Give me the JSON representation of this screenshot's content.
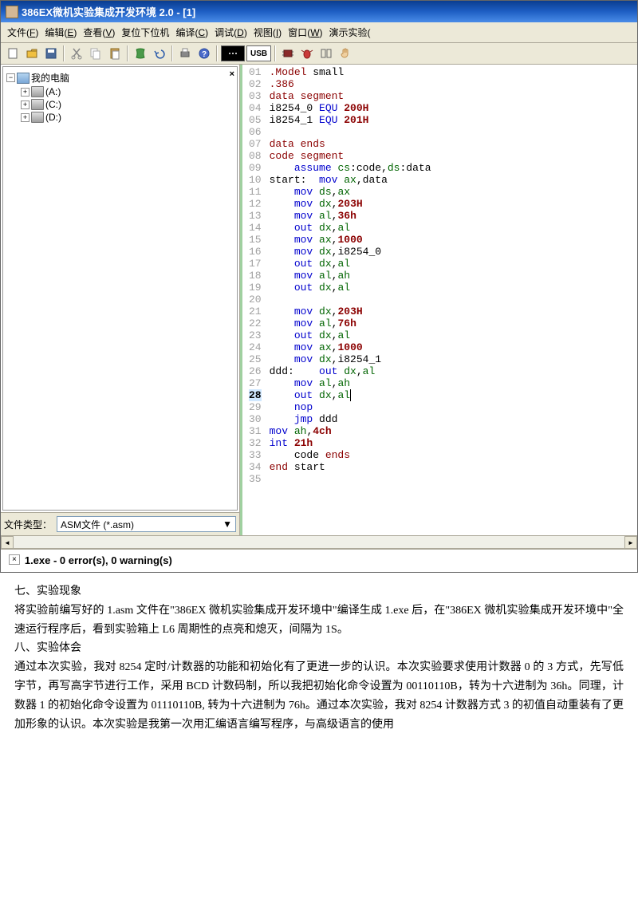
{
  "window": {
    "title": "386EX微机实验集成开发环境 2.0 - [1]"
  },
  "menu": {
    "file": {
      "label": "文件",
      "hotkey": "F"
    },
    "edit": {
      "label": "编辑",
      "hotkey": "E"
    },
    "view": {
      "label": "查看",
      "hotkey": "V"
    },
    "reset": {
      "label": "复位下位机"
    },
    "compile": {
      "label": "编译",
      "hotkey": "C"
    },
    "debug": {
      "label": "调试",
      "hotkey": "D"
    },
    "viewport": {
      "label": "视图",
      "hotkey": "I"
    },
    "window": {
      "label": "窗口",
      "hotkey": "W"
    },
    "demo": {
      "label": "演示实验"
    }
  },
  "toolbar": {
    "usb": "USB"
  },
  "tree": {
    "root": "我的电脑",
    "drives": [
      "(A:)",
      "(C:)",
      "(D:)"
    ]
  },
  "filetype": {
    "label": "文件类型：",
    "value": "ASM文件 (*.asm)"
  },
  "code": {
    "lines": [
      {
        "n": "01",
        "tokens": [
          [
            "dir",
            ".Model"
          ],
          [
            "plain",
            " small"
          ]
        ]
      },
      {
        "n": "02",
        "tokens": [
          [
            "dir",
            ".386"
          ]
        ]
      },
      {
        "n": "03",
        "tokens": [
          [
            "dir",
            "data segment"
          ]
        ]
      },
      {
        "n": "04",
        "tokens": [
          [
            "plain",
            "i8254_0 "
          ],
          [
            "inst",
            "EQU"
          ],
          [
            "plain",
            " "
          ],
          [
            "num",
            "200H"
          ]
        ]
      },
      {
        "n": "05",
        "tokens": [
          [
            "plain",
            "i8254_1 "
          ],
          [
            "inst",
            "EQU"
          ],
          [
            "plain",
            " "
          ],
          [
            "num",
            "201H"
          ]
        ]
      },
      {
        "n": "06",
        "tokens": []
      },
      {
        "n": "07",
        "tokens": [
          [
            "dir",
            "data ends"
          ]
        ]
      },
      {
        "n": "08",
        "tokens": [
          [
            "dir",
            "code segment"
          ]
        ]
      },
      {
        "n": "09",
        "tokens": [
          [
            "plain",
            "    "
          ],
          [
            "inst",
            "assume"
          ],
          [
            "plain",
            " "
          ],
          [
            "reg",
            "cs"
          ],
          [
            "plain",
            ":code,"
          ],
          [
            "reg",
            "ds"
          ],
          [
            "plain",
            ":data"
          ]
        ]
      },
      {
        "n": "10",
        "tokens": [
          [
            "plain",
            "start:  "
          ],
          [
            "inst",
            "mov"
          ],
          [
            "plain",
            " "
          ],
          [
            "reg",
            "ax"
          ],
          [
            "plain",
            ",data"
          ]
        ]
      },
      {
        "n": "11",
        "tokens": [
          [
            "plain",
            "    "
          ],
          [
            "inst",
            "mov"
          ],
          [
            "plain",
            " "
          ],
          [
            "reg",
            "ds"
          ],
          [
            "plain",
            ","
          ],
          [
            "reg",
            "ax"
          ]
        ]
      },
      {
        "n": "12",
        "tokens": [
          [
            "plain",
            "    "
          ],
          [
            "inst",
            "mov"
          ],
          [
            "plain",
            " "
          ],
          [
            "reg",
            "dx"
          ],
          [
            "plain",
            ","
          ],
          [
            "num",
            "203H"
          ]
        ]
      },
      {
        "n": "13",
        "tokens": [
          [
            "plain",
            "    "
          ],
          [
            "inst",
            "mov"
          ],
          [
            "plain",
            " "
          ],
          [
            "reg",
            "al"
          ],
          [
            "plain",
            ","
          ],
          [
            "num",
            "36h"
          ]
        ]
      },
      {
        "n": "14",
        "tokens": [
          [
            "plain",
            "    "
          ],
          [
            "inst",
            "out"
          ],
          [
            "plain",
            " "
          ],
          [
            "reg",
            "dx"
          ],
          [
            "plain",
            ","
          ],
          [
            "reg",
            "al"
          ]
        ]
      },
      {
        "n": "15",
        "tokens": [
          [
            "plain",
            "    "
          ],
          [
            "inst",
            "mov"
          ],
          [
            "plain",
            " "
          ],
          [
            "reg",
            "ax"
          ],
          [
            "plain",
            ","
          ],
          [
            "num",
            "1000"
          ]
        ]
      },
      {
        "n": "16",
        "tokens": [
          [
            "plain",
            "    "
          ],
          [
            "inst",
            "mov"
          ],
          [
            "plain",
            " "
          ],
          [
            "reg",
            "dx"
          ],
          [
            "plain",
            ",i8254_0"
          ]
        ]
      },
      {
        "n": "17",
        "tokens": [
          [
            "plain",
            "    "
          ],
          [
            "inst",
            "out"
          ],
          [
            "plain",
            " "
          ],
          [
            "reg",
            "dx"
          ],
          [
            "plain",
            ","
          ],
          [
            "reg",
            "al"
          ]
        ]
      },
      {
        "n": "18",
        "tokens": [
          [
            "plain",
            "    "
          ],
          [
            "inst",
            "mov"
          ],
          [
            "plain",
            " "
          ],
          [
            "reg",
            "al"
          ],
          [
            "plain",
            ","
          ],
          [
            "reg",
            "ah"
          ]
        ]
      },
      {
        "n": "19",
        "tokens": [
          [
            "plain",
            "    "
          ],
          [
            "inst",
            "out"
          ],
          [
            "plain",
            " "
          ],
          [
            "reg",
            "dx"
          ],
          [
            "plain",
            ","
          ],
          [
            "reg",
            "al"
          ]
        ]
      },
      {
        "n": "20",
        "tokens": []
      },
      {
        "n": "21",
        "tokens": [
          [
            "plain",
            "    "
          ],
          [
            "inst",
            "mov"
          ],
          [
            "plain",
            " "
          ],
          [
            "reg",
            "dx"
          ],
          [
            "plain",
            ","
          ],
          [
            "num",
            "203H"
          ]
        ]
      },
      {
        "n": "22",
        "tokens": [
          [
            "plain",
            "    "
          ],
          [
            "inst",
            "mov"
          ],
          [
            "plain",
            " "
          ],
          [
            "reg",
            "al"
          ],
          [
            "plain",
            ","
          ],
          [
            "num",
            "76h"
          ]
        ]
      },
      {
        "n": "23",
        "tokens": [
          [
            "plain",
            "    "
          ],
          [
            "inst",
            "out"
          ],
          [
            "plain",
            " "
          ],
          [
            "reg",
            "dx"
          ],
          [
            "plain",
            ","
          ],
          [
            "reg",
            "al"
          ]
        ]
      },
      {
        "n": "24",
        "tokens": [
          [
            "plain",
            "    "
          ],
          [
            "inst",
            "mov"
          ],
          [
            "plain",
            " "
          ],
          [
            "reg",
            "ax"
          ],
          [
            "plain",
            ","
          ],
          [
            "num",
            "1000"
          ]
        ]
      },
      {
        "n": "25",
        "tokens": [
          [
            "plain",
            "    "
          ],
          [
            "inst",
            "mov"
          ],
          [
            "plain",
            " "
          ],
          [
            "reg",
            "dx"
          ],
          [
            "plain",
            ",i8254_1"
          ]
        ]
      },
      {
        "n": "26",
        "tokens": [
          [
            "plain",
            "ddd:    "
          ],
          [
            "inst",
            "out"
          ],
          [
            "plain",
            " "
          ],
          [
            "reg",
            "dx"
          ],
          [
            "plain",
            ","
          ],
          [
            "reg",
            "al"
          ]
        ]
      },
      {
        "n": "27",
        "tokens": [
          [
            "plain",
            "    "
          ],
          [
            "inst",
            "mov"
          ],
          [
            "plain",
            " "
          ],
          [
            "reg",
            "al"
          ],
          [
            "plain",
            ","
          ],
          [
            "reg",
            "ah"
          ]
        ]
      },
      {
        "n": "28",
        "tokens": [
          [
            "plain",
            "    "
          ],
          [
            "inst",
            "out"
          ],
          [
            "plain",
            " "
          ],
          [
            "reg",
            "dx"
          ],
          [
            "plain",
            ","
          ],
          [
            "reg",
            "al"
          ]
        ],
        "current": true
      },
      {
        "n": "29",
        "tokens": [
          [
            "plain",
            "    "
          ],
          [
            "inst",
            "nop"
          ]
        ]
      },
      {
        "n": "30",
        "tokens": [
          [
            "plain",
            "    "
          ],
          [
            "inst",
            "jmp"
          ],
          [
            "plain",
            " ddd"
          ]
        ]
      },
      {
        "n": "31",
        "tokens": [
          [
            "inst",
            "mov"
          ],
          [
            "plain",
            " "
          ],
          [
            "reg",
            "ah"
          ],
          [
            "plain",
            ","
          ],
          [
            "num",
            "4ch"
          ]
        ]
      },
      {
        "n": "32",
        "tokens": [
          [
            "inst",
            "int"
          ],
          [
            "plain",
            " "
          ],
          [
            "num",
            "21h"
          ]
        ]
      },
      {
        "n": "33",
        "tokens": [
          [
            "plain",
            "    code "
          ],
          [
            "dir",
            "ends"
          ]
        ]
      },
      {
        "n": "34",
        "tokens": [
          [
            "dir",
            "end"
          ],
          [
            "plain",
            " start"
          ]
        ]
      },
      {
        "n": "35",
        "tokens": []
      }
    ]
  },
  "output": {
    "text": "1.exe - 0 error(s), 0 warning(s)"
  },
  "doc": {
    "h7": "七、实验现象",
    "p1": "将实验前编写好的 1.asm 文件在\"386EX 微机实验集成开发环境中\"编译生成 1.exe 后，在\"386EX 微机实验集成开发环境中\"全速运行程序后，看到实验箱上 L6 周期性的点亮和熄灭，间隔为 1S。",
    "h8": "八、实验体会",
    "p2": "通过本次实验，我对 8254 定时/计数器的功能和初始化有了更进一步的认识。本次实验要求使用计数器 0 的 3 方式，先写低字节，再写高字节进行工作，采用 BCD 计数码制，所以我把初始化命令设置为 00110110B，转为十六进制为 36h。同理，计数器 1  的初始化命令设置为 01110110B, 转为十六进制为 76h。通过本次实验，我对 8254 计数器方式 3 的初值自动重装有了更加形象的认识。本次实验是我第一次用汇编语言编写程序，与高级语言的使用"
  }
}
